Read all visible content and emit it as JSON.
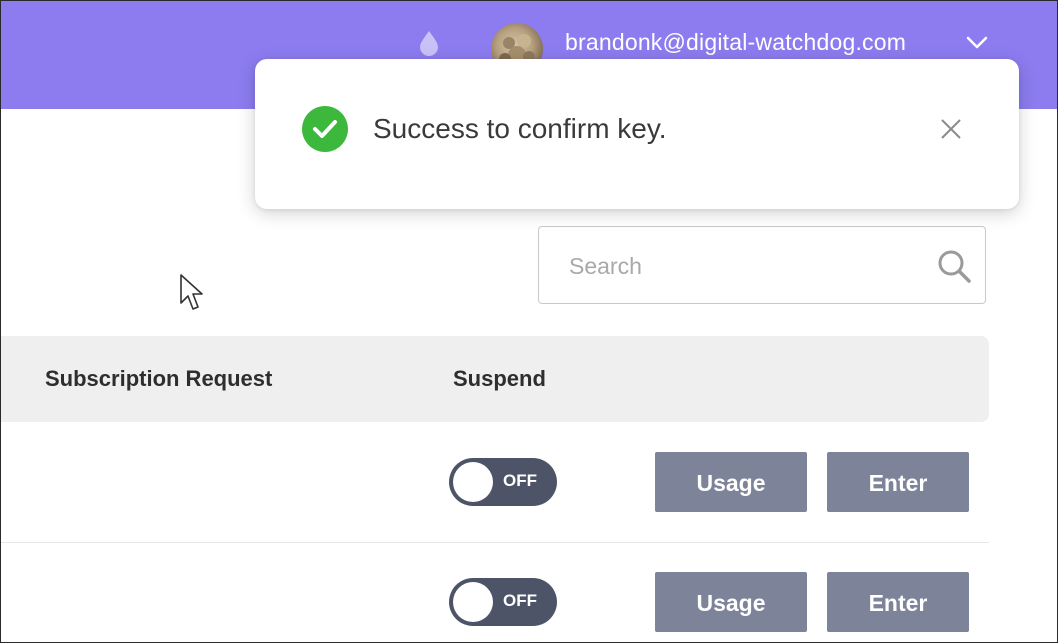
{
  "header": {
    "user_email": "brandonk@digital-watchdog.com",
    "background_color": "#8c7cf0",
    "icons": {
      "notification": "droplet-icon",
      "menu": "chevron-down-icon"
    }
  },
  "toast": {
    "status": "success",
    "message": "Success to confirm key.",
    "icon": "check-circle-icon",
    "icon_color": "#3cb93c",
    "close_icon": "close-icon"
  },
  "search": {
    "placeholder": "Search",
    "value": "",
    "icon": "search-icon"
  },
  "table": {
    "columns": [
      "Subscription Request",
      "Suspend"
    ],
    "rows": [
      {
        "suspend_toggle": "OFF",
        "usage_label": "Usage",
        "enter_label": "Enter"
      },
      {
        "suspend_toggle": "OFF",
        "usage_label": "Usage",
        "enter_label": "Enter"
      }
    ]
  },
  "colors": {
    "accent": "#8c7cf0",
    "button": "#7d8399",
    "toggle_off": "#4d5468",
    "success": "#3cb93c"
  }
}
